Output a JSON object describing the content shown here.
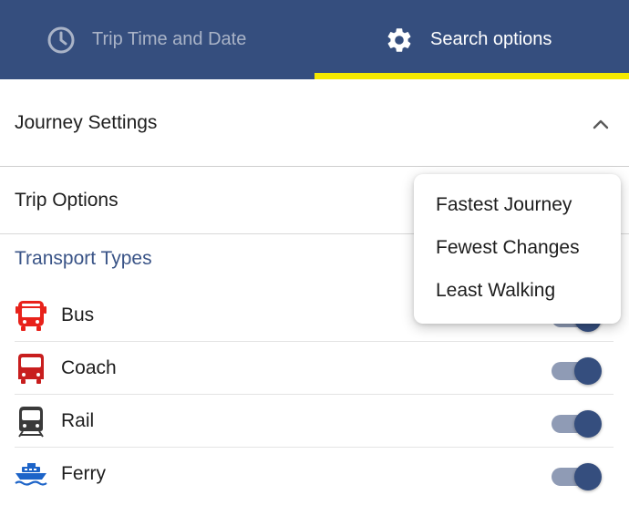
{
  "tabs": [
    {
      "label": "Trip Time and Date",
      "icon": "clock-icon",
      "active": false
    },
    {
      "label": "Search options",
      "icon": "gear-icon",
      "active": true
    }
  ],
  "colors": {
    "header_bg": "#354e7e",
    "active_indicator": "#f5e900",
    "accent_text": "#3a5487",
    "toggle_thumb": "#354e7e",
    "toggle_track": "#8f9bb5",
    "bus_red": "#e8221b",
    "coach_red": "#c81e1e",
    "ferry_blue": "#1d64c8"
  },
  "journey_settings": {
    "title": "Journey Settings",
    "expanded": true,
    "icon": "chevron-up-icon"
  },
  "trip_options": {
    "label": "Trip Options"
  },
  "trip_options_menu": {
    "items": [
      "Fastest Journey",
      "Fewest Changes",
      "Least Walking"
    ]
  },
  "transport": {
    "title": "Transport Types",
    "items": [
      {
        "label": "Bus",
        "icon": "bus-icon",
        "enabled": true
      },
      {
        "label": "Coach",
        "icon": "coach-icon",
        "enabled": true
      },
      {
        "label": "Rail",
        "icon": "train-icon",
        "enabled": true
      },
      {
        "label": "Ferry",
        "icon": "ferry-icon",
        "enabled": true
      }
    ]
  }
}
